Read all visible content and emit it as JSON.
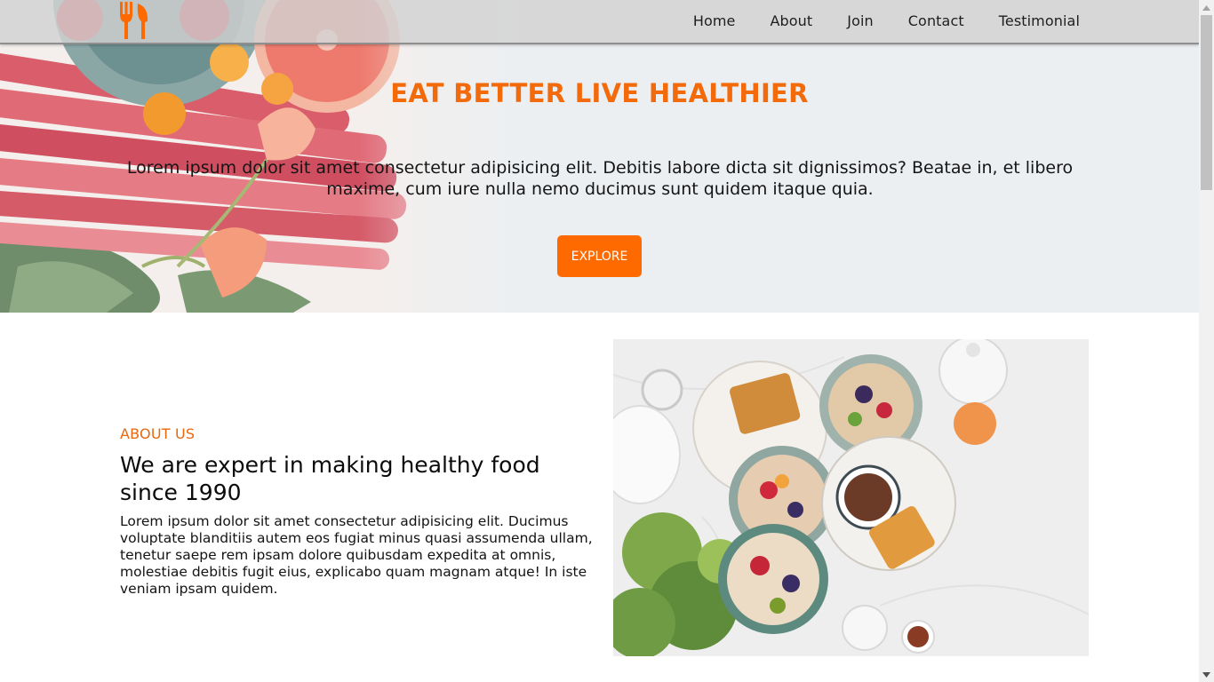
{
  "nav": {
    "logo": "fork-and-knife-logo",
    "links": [
      "Home",
      "About",
      "Join",
      "Contact",
      "Testimonial"
    ]
  },
  "hero": {
    "title": "EAT BETTER LIVE HEALTHIER",
    "text": "Lorem ipsum dolor sit amet consectetur adipisicing elit. Debitis labore dicta sit dignissimos? Beatae in, et libero maxime, cum iure nulla nemo ducimus sunt quidem itaque quia.",
    "button_label": "EXPLORE"
  },
  "about": {
    "kicker": "ABOUT US",
    "heading": "We are expert in making healthy food since 1990",
    "text": "Lorem ipsum dolor sit amet consectetur adipisicing elit. Ducimus voluptate blanditiis autem eos fugiat minus quasi assumenda ullam, tenetur saepe rem ipsam dolore quibusdam expedita at omnis, molestiae debitis fugit eius, explicabo quam magnam atque! In iste veniam ipsam quidem."
  },
  "colors": {
    "accent": "#ff6a00",
    "title_orange": "#f26a0a",
    "navbar": "#d2d2d2"
  }
}
